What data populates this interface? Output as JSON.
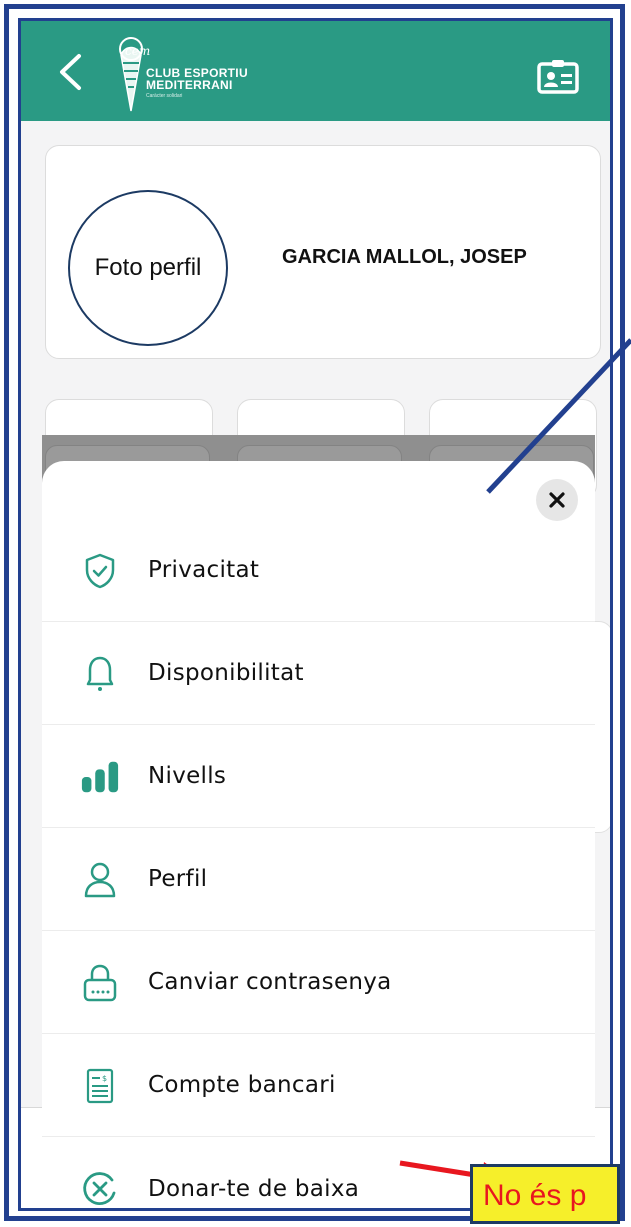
{
  "header": {
    "club_name_line1": "CLUB ESPORTIU",
    "club_name_line2": "MEDITERRANI",
    "club_tagline": "Caràcter solidari",
    "logo_letters": "cem",
    "accent_color": "#2a9a84"
  },
  "profile": {
    "avatar_text": "Foto perfil",
    "name": "GARCIA MALLOL, JOSEP"
  },
  "menu": {
    "items": [
      {
        "label": "Privacitat",
        "icon": "shield-check-icon"
      },
      {
        "label": "Disponibilitat",
        "icon": "bell-icon"
      },
      {
        "label": "Nivells",
        "icon": "bars-level-icon"
      },
      {
        "label": "Perfil",
        "icon": "user-icon"
      },
      {
        "label": "Canviar contrasenya",
        "icon": "lock-icon"
      },
      {
        "label": "Compte bancari",
        "icon": "bank-statement-icon"
      },
      {
        "label": "Donar-te de baixa",
        "icon": "close-circle-icon"
      }
    ]
  },
  "annotation": {
    "note_text": "No és p",
    "note_color": "#e8171f",
    "note_background": "#f6ef2a"
  }
}
